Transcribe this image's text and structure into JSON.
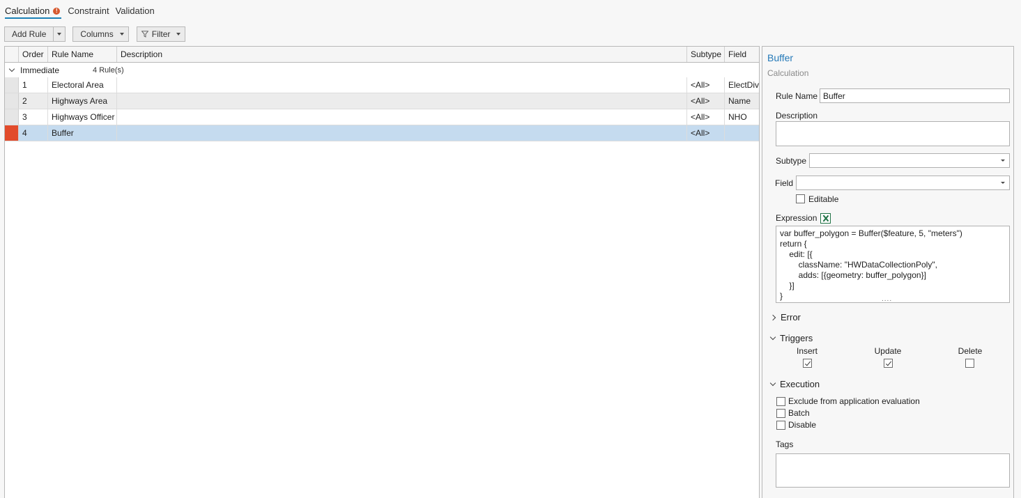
{
  "tabs": [
    {
      "label": "Calculation",
      "active": true,
      "warning": "!"
    },
    {
      "label": "Constraint",
      "active": false
    },
    {
      "label": "Validation",
      "active": false
    }
  ],
  "toolbar": {
    "add_rule": "Add Rule",
    "columns": "Columns",
    "filter": "Filter"
  },
  "grid": {
    "headers": {
      "order": "Order",
      "rule_name": "Rule Name",
      "description": "Description",
      "subtype": "Subtype",
      "field": "Field"
    },
    "group": {
      "label": "Immediate",
      "count": "4 Rule(s)"
    },
    "rows": [
      {
        "order": "1",
        "rule_name": "Electoral Area",
        "description": "",
        "subtype": "<All>",
        "field": "ElectDiv"
      },
      {
        "order": "2",
        "rule_name": "Highways Area",
        "description": "",
        "subtype": "<All>",
        "field": "Name"
      },
      {
        "order": "3",
        "rule_name": "Highways Officer",
        "description": "",
        "subtype": "<All>",
        "field": "NHO"
      },
      {
        "order": "4",
        "rule_name": "Buffer",
        "description": "",
        "subtype": "<All>",
        "field": ""
      }
    ]
  },
  "panel": {
    "title": "Buffer",
    "subtitle": "Calculation",
    "rule_name_label": "Rule Name",
    "rule_name_value": "Buffer",
    "description_label": "Description",
    "subtype_label": "Subtype",
    "field_label": "Field",
    "editable_label": "Editable",
    "expression_label": "Expression",
    "expression": "var buffer_polygon = Buffer($feature, 5, \"meters\")\nreturn {\n    edit: [{\n        className: \"HWDataCollectionPoly\",\n        adds: [{geometry: buffer_polygon}]\n    }]\n}",
    "error_label": "Error",
    "triggers_label": "Triggers",
    "triggers": {
      "insert": "Insert",
      "update": "Update",
      "delete": "Delete"
    },
    "execution_label": "Execution",
    "execution": {
      "exclude": "Exclude from application evaluation",
      "batch": "Batch",
      "disable": "Disable"
    },
    "tags_label": "Tags"
  },
  "colors": {
    "accent": "#1b80b6",
    "title": "#2479b8",
    "selection": "#c5dbef",
    "marker": "#e24b2b",
    "warning": "#d6592f"
  }
}
